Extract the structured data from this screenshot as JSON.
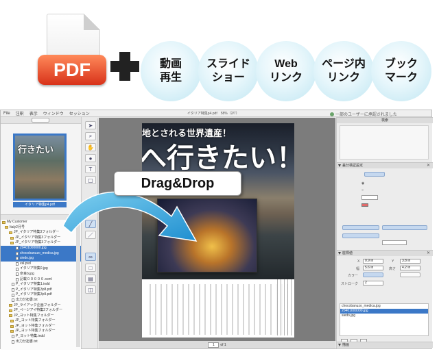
{
  "banner": {
    "pdf_label": "PDF",
    "features": [
      {
        "label": "動画\n再生"
      },
      {
        "label": "スライド\nショー"
      },
      {
        "label": "Web\nリンク"
      },
      {
        "label": "ページ内\nリンク"
      },
      {
        "label": "ブック\nマーク"
      }
    ]
  },
  "overlay": {
    "drag_label": "Drag&Drop",
    "arrow_color": "#2a9fd6"
  },
  "app": {
    "menu": [
      "File",
      "注釈",
      "表示",
      "ウィンドウ",
      "セッション"
    ],
    "document_title": "イタリア特集p4.pdf　58%（2/7）",
    "notice": "一部のユーザーに承認されました",
    "left_panel": {
      "thumbnail_title": "行きたい",
      "thumbnail_caption": "イタリア特集p4.pdf",
      "tree": [
        {
          "label": "My Customer",
          "type": "folder",
          "selected": false
        },
        {
          "label": "Italy2月号",
          "type": "folder",
          "selected": false
        },
        {
          "label": "JP_イタリア特集3フォルダー",
          "type": "folder",
          "selected": false
        },
        {
          "label": "JP_イタリア特集3フォルダー",
          "type": "folder",
          "selected": false
        },
        {
          "label": "JP_イタリア特集3フォルダー",
          "type": "folder",
          "selected": false
        },
        {
          "label": "20401000000.jpg",
          "type": "file",
          "selected": true
        },
        {
          "label": "chocobanuzo_medica.jpg",
          "type": "file",
          "selected": true
        },
        {
          "label": "siedo.jpg",
          "type": "file",
          "selected": true
        },
        {
          "label": "val.psd",
          "type": "file",
          "selected": false
        },
        {
          "label": "イタリア特集0.jpg",
          "type": "file",
          "selected": false
        },
        {
          "label": "奈良b.jpg",
          "type": "file",
          "selected": false
        },
        {
          "label": "記載０００００.xcml",
          "type": "file",
          "selected": false
        },
        {
          "label": "P_イタリア特集1.indd",
          "type": "file",
          "selected": false
        },
        {
          "label": "P_イタリア特集3p8.pdf",
          "type": "file",
          "selected": false
        },
        {
          "label": "P_イタリア特集3p9.pdf",
          "type": "file",
          "selected": false
        },
        {
          "label": "出力分担書.txt",
          "type": "file",
          "selected": false
        },
        {
          "label": "JP_ライアック企画フォルダー",
          "type": "folder",
          "selected": false
        },
        {
          "label": "JP_ページアイ特集2フォルダー",
          "type": "folder",
          "selected": false
        },
        {
          "label": "JP_ヨット特集フォルダー",
          "type": "folder",
          "selected": false
        },
        {
          "label": "JP_ヨット特集フォルダー",
          "type": "folder",
          "selected": false
        },
        {
          "label": "JP_ヨット特集フォルダー",
          "type": "folder",
          "selected": false
        },
        {
          "label": "JP_ヨット特集フォルダー",
          "type": "folder",
          "selected": false
        },
        {
          "label": "P_ヨット特集.indd",
          "type": "file",
          "selected": false
        },
        {
          "label": "出力分担書.txt",
          "type": "file",
          "selected": false
        }
      ]
    },
    "page": {
      "subtitle": "地とされる世界遺産！",
      "heading": "へ行きたい！"
    },
    "pager": {
      "current": "1",
      "total_text": "of 1"
    },
    "right_panel": {
      "search_title": "検索",
      "sec1_title": "差分検証設定",
      "sec2_title": "座標値",
      "sec3_title": "描画",
      "fields": {
        "x_label": "X",
        "x_value": "0.9 in",
        "y_label": "Y",
        "y_value": "3.8 in",
        "w_label": "幅",
        "w_value": "5.6 in",
        "h_label": "高さ",
        "h_value": "4.2 in",
        "color_label": "カラー",
        "stroke_label": "ストローク",
        "stroke_value": "2"
      },
      "files": [
        {
          "label": "chocobanuzo_medica.jpg",
          "selected": false
        },
        {
          "label": "20401000000.jpg",
          "selected": true
        },
        {
          "label": "siedo.jpg",
          "selected": false
        }
      ]
    }
  },
  "colors": {
    "accent_blue": "#3b78c7",
    "pdf_red": "#e0462e",
    "bubble": "#bfe6f2"
  }
}
